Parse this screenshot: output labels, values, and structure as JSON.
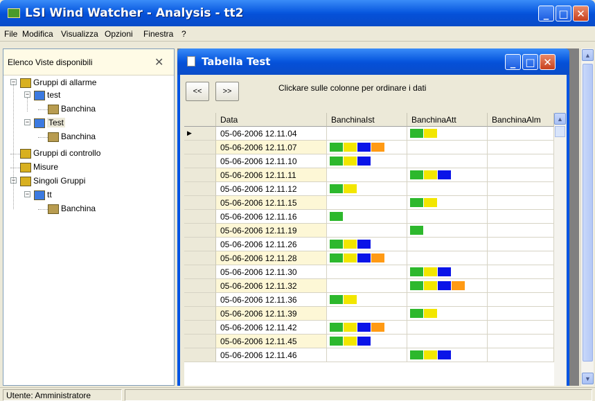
{
  "window": {
    "title": "LSI Wind Watcher - Analysis - tt2"
  },
  "menu": [
    "File",
    "Modifica",
    "Visualizza",
    "Opzioni",
    "Finestra",
    "?"
  ],
  "left_panel": {
    "header": "Elenco Viste disponibili",
    "tree": [
      {
        "label": "Gruppi di allarme",
        "expander": "−"
      },
      {
        "label": "test",
        "expander": "−"
      },
      {
        "label": "Banchina"
      },
      {
        "label": "Test",
        "expander": "−"
      },
      {
        "label": "Banchina"
      },
      {
        "label": "Gruppi di controllo"
      },
      {
        "label": "Misure"
      },
      {
        "label": "Singoli Gruppi",
        "expander": "−"
      },
      {
        "label": "tt",
        "expander": "−"
      },
      {
        "label": "Banchina"
      }
    ]
  },
  "child_window": {
    "title": "Tabella Test",
    "prev_label": "<<",
    "next_label": ">>",
    "hint": "Clickare sulle colonne per ordinare i dati",
    "columns": [
      "Data",
      "BanchinaIst",
      "BanchinaAtt",
      "BanchinaAlm"
    ],
    "current_row_marker": "▶",
    "colors": {
      "green": "#2db82d",
      "yellow": "#f2e600",
      "blue": "#0a14e8",
      "orange": "#ff9a14",
      "alt_row": "#fdf7d6"
    },
    "rows": [
      {
        "date": "05-06-2006 12.11.04",
        "ist": [],
        "att": [
          "green",
          "yellow"
        ]
      },
      {
        "date": "05-06-2006 12.11.07",
        "ist": [
          "green",
          "yellow",
          "blue",
          "orange"
        ],
        "att": []
      },
      {
        "date": "05-06-2006 12.11.10",
        "ist": [
          "green",
          "yellow",
          "blue"
        ],
        "att": []
      },
      {
        "date": "05-06-2006 12.11.11",
        "ist": [],
        "att": [
          "green",
          "yellow",
          "blue"
        ]
      },
      {
        "date": "05-06-2006 12.11.12",
        "ist": [
          "green",
          "yellow"
        ],
        "att": []
      },
      {
        "date": "05-06-2006 12.11.15",
        "ist": [],
        "att": [
          "green",
          "yellow"
        ]
      },
      {
        "date": "05-06-2006 12.11.16",
        "ist": [
          "green"
        ],
        "att": []
      },
      {
        "date": "05-06-2006 12.11.19",
        "ist": [],
        "att": [
          "green"
        ]
      },
      {
        "date": "05-06-2006 12.11.26",
        "ist": [
          "green",
          "yellow",
          "blue"
        ],
        "att": []
      },
      {
        "date": "05-06-2006 12.11.28",
        "ist": [
          "green",
          "yellow",
          "blue",
          "orange"
        ],
        "att": []
      },
      {
        "date": "05-06-2006 12.11.30",
        "ist": [],
        "att": [
          "green",
          "yellow",
          "blue"
        ]
      },
      {
        "date": "05-06-2006 12.11.32",
        "ist": [],
        "att": [
          "green",
          "yellow",
          "blue",
          "orange"
        ]
      },
      {
        "date": "05-06-2006 12.11.36",
        "ist": [
          "green",
          "yellow"
        ],
        "att": []
      },
      {
        "date": "05-06-2006 12.11.39",
        "ist": [],
        "att": [
          "green",
          "yellow"
        ]
      },
      {
        "date": "05-06-2006 12.11.42",
        "ist": [
          "green",
          "yellow",
          "blue",
          "orange"
        ],
        "att": []
      },
      {
        "date": "05-06-2006 12.11.45",
        "ist": [
          "green",
          "yellow",
          "blue"
        ],
        "att": []
      },
      {
        "date": "05-06-2006 12.11.46",
        "ist": [],
        "att": [
          "green",
          "yellow",
          "blue"
        ]
      }
    ]
  },
  "status": {
    "user": "Utente: Amministratore"
  }
}
